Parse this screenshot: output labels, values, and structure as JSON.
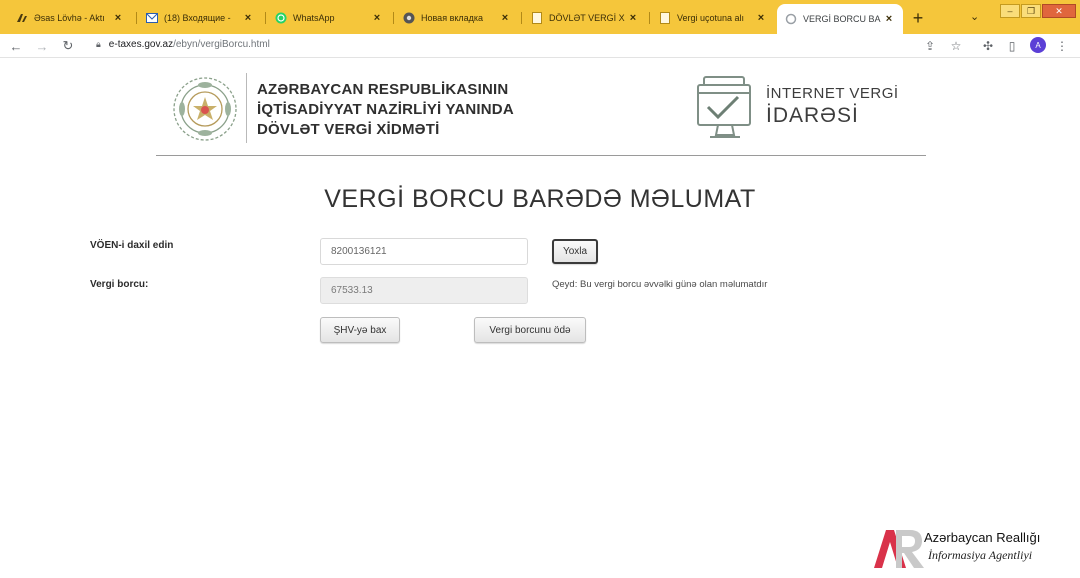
{
  "browser": {
    "tabs": [
      {
        "title": "Əsas Lövhə - Aktı",
        "icon": "ebrand-icon"
      },
      {
        "title": "(18) Входящие - ",
        "icon": "mail-icon"
      },
      {
        "title": "WhatsApp",
        "icon": "whatsapp-icon"
      },
      {
        "title": "Новая вкладка",
        "icon": "chrome-icon"
      },
      {
        "title": "DÖVLƏT VERGİ X",
        "icon": "page-icon"
      },
      {
        "title": "Vergi uçotuna alı",
        "icon": "page-icon"
      },
      {
        "title": "VERGİ BORCU BA",
        "icon": "loading-icon",
        "active": true
      }
    ],
    "new_tab": "+",
    "url_domain": "e-taxes.gov.az",
    "url_path": "/ebyn/vergiBorcu.html",
    "avatar_letter": "A",
    "accent": "#f5c63b"
  },
  "header": {
    "org_lines": [
      "AZƏRBAYCAN RESPUBLİKASININ",
      "İQTİSADİYYAT NAZİRLİYİ YANINDA",
      "DÖVLƏT VERGİ XİDMƏTİ"
    ],
    "portal_line1": "İNTERNET VERGİ",
    "portal_line2": "İDARƏSİ"
  },
  "main": {
    "title": "VERGİ BORCU BARƏDƏ MƏLUMAT",
    "voen_label": "VÖEN-i daxil edin",
    "voen_value": "8200136121",
    "check_button": "Yoxla",
    "debt_label": "Vergi borcu:",
    "debt_value": "67533.13",
    "note": "Qeyd: Bu vergi borcu əvvəlki günə olan məlumatdır",
    "shv_button": "ŞHV-yə bax",
    "pay_button": "Vergi borcunu ödə"
  },
  "watermark": {
    "logo": "AR",
    "name": "Azərbaycan Reallığı",
    "subtitle": "İnformasiya Agentliyi"
  }
}
